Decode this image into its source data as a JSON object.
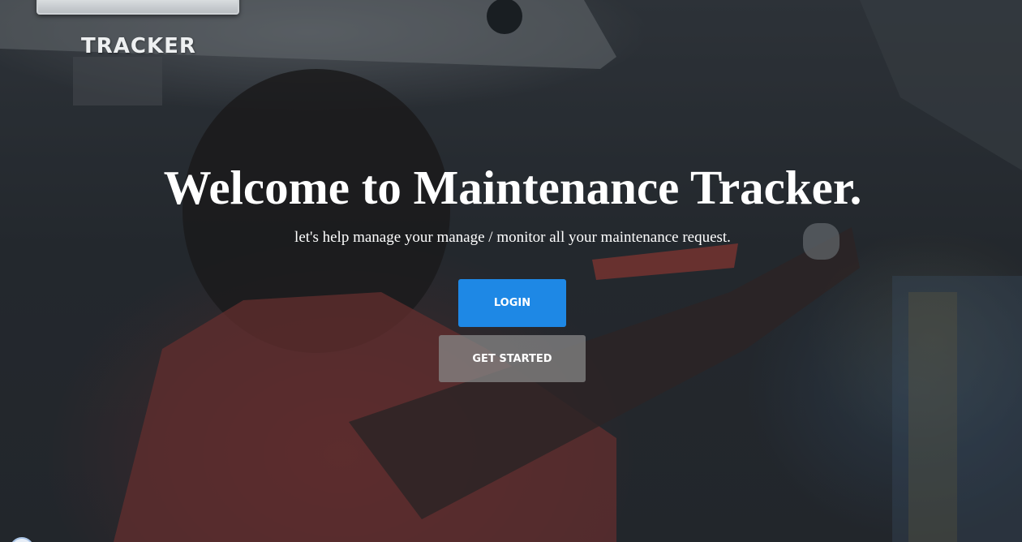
{
  "brand": {
    "name": "TRACKER"
  },
  "hero": {
    "title": "Welcome to Maintenance Tracker.",
    "subtitle": "let's help manage your manage / monitor all your maintenance request."
  },
  "buttons": {
    "login": "LOGIN",
    "get_started": "GET STARTED"
  },
  "colors": {
    "login_button": "#1e88e5",
    "get_started_button": "#878787",
    "text": "#ffffff"
  }
}
